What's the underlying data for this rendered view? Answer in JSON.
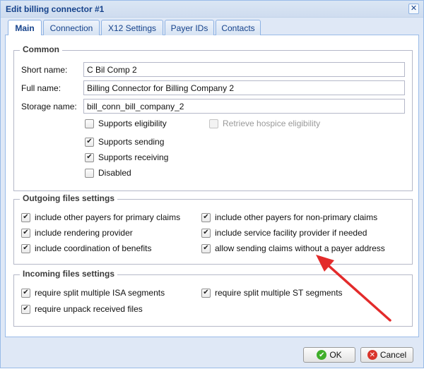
{
  "window": {
    "title": "Edit billing connector #1",
    "close_symbol": "✕"
  },
  "tabs": [
    {
      "label": "Main",
      "active": true
    },
    {
      "label": "Connection",
      "active": false
    },
    {
      "label": "X12 Settings",
      "active": false
    },
    {
      "label": "Payer IDs",
      "active": false
    },
    {
      "label": "Contacts",
      "active": false
    }
  ],
  "common": {
    "legend": "Common",
    "short_name": {
      "label": "Short name:",
      "value": "C Bil Comp 2"
    },
    "full_name": {
      "label": "Full name:",
      "value": "Billing Connector for Billing Company 2"
    },
    "storage_name": {
      "label": "Storage name:",
      "value": "bill_conn_bill_company_2"
    },
    "checkboxes": {
      "supports_eligibility": {
        "label": "Supports eligibility",
        "checked": false
      },
      "retrieve_hospice": {
        "label": "Retrieve hospice eligibility",
        "checked": false,
        "disabled": true
      },
      "supports_sending": {
        "label": "Supports sending",
        "checked": true
      },
      "supports_receiving": {
        "label": "Supports receiving",
        "checked": true
      },
      "disabled": {
        "label": "Disabled",
        "checked": false
      }
    }
  },
  "outgoing": {
    "legend": "Outgoing files settings",
    "items": [
      {
        "label": "include other payers for primary claims",
        "checked": true
      },
      {
        "label": "include other payers for non-primary claims",
        "checked": true
      },
      {
        "label": "include rendering provider",
        "checked": true
      },
      {
        "label": "include service facility provider if needed",
        "checked": true
      },
      {
        "label": "include coordination of benefits",
        "checked": true
      },
      {
        "label": "allow sending claims without a payer address",
        "checked": true
      }
    ]
  },
  "incoming": {
    "legend": "Incoming files settings",
    "items": [
      {
        "label": "require split multiple ISA segments",
        "checked": true
      },
      {
        "label": "require split multiple ST segments",
        "checked": true
      },
      {
        "label": "require unpack received files",
        "checked": true
      }
    ]
  },
  "buttons": {
    "ok": "OK",
    "cancel": "Cancel"
  },
  "colors": {
    "annotation_arrow": "#e32b2b",
    "ok_icon": "#3fae2a",
    "cancel_icon": "#d9342b"
  },
  "check_mark": "✔"
}
